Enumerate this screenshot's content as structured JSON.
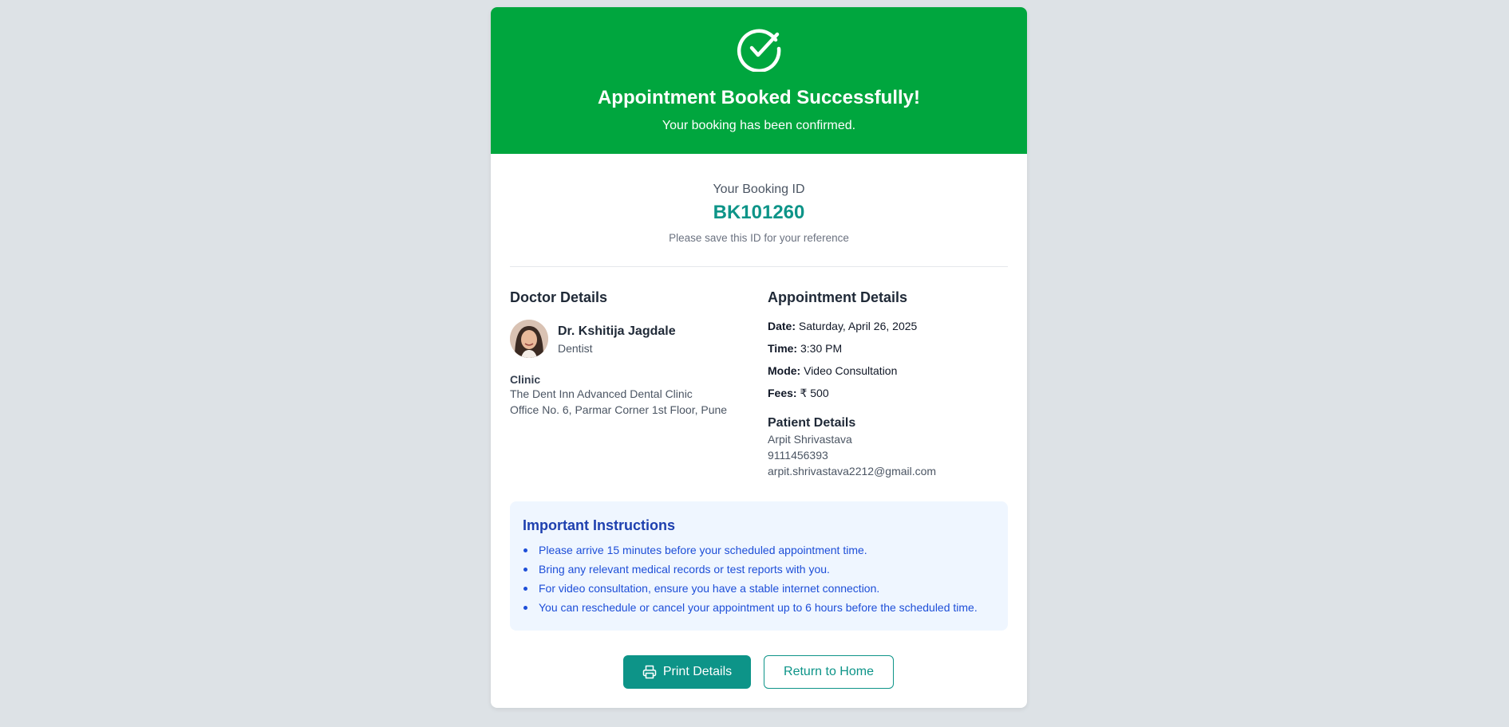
{
  "banner": {
    "title": "Appointment Booked Successfully!",
    "subtitle": "Your booking has been confirmed.",
    "icon": "check-circle-icon",
    "color": "#00a63e"
  },
  "booking": {
    "label": "Your Booking ID",
    "id": "BK101260",
    "note": "Please save this ID for your reference"
  },
  "doctor": {
    "heading": "Doctor Details",
    "name": "Dr. Kshitija Jagdale",
    "specialty": "Dentist",
    "clinic_label": "Clinic",
    "clinic_name": "The Dent Inn Advanced Dental Clinic",
    "clinic_address": "Office No. 6, Parmar Corner 1st Floor, Pune"
  },
  "appointment": {
    "heading": "Appointment Details",
    "date_label": "Date:",
    "date": "Saturday, April 26, 2025",
    "time_label": "Time:",
    "time": "3:30 PM",
    "mode_label": "Mode:",
    "mode": "Video Consultation",
    "fees_label": "Fees:",
    "fees": "₹ 500"
  },
  "patient": {
    "heading": "Patient Details",
    "name": "Arpit Shrivastava",
    "phone": "9111456393",
    "email": "arpit.shrivastava2212@gmail.com"
  },
  "instructions": {
    "heading": "Important Instructions",
    "items": [
      "Please arrive 15 minutes before your scheduled appointment time.",
      "Bring any relevant medical records or test reports with you.",
      "For video consultation, ensure you have a stable internet connection.",
      "You can reschedule or cancel your appointment up to 6 hours before the scheduled time."
    ]
  },
  "actions": {
    "print_label": "Print Details",
    "print_icon": "printer-icon",
    "home_label": "Return to Home",
    "accent": "#0d9488"
  }
}
